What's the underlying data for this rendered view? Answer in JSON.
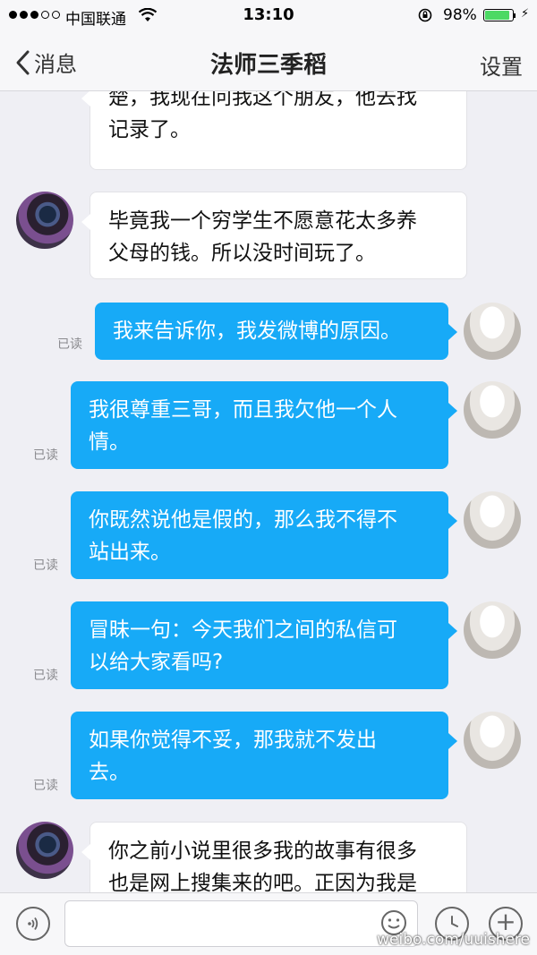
{
  "status_bar": {
    "carrier": "中国联通",
    "time": "13:10",
    "battery": "98%"
  },
  "nav": {
    "back_label": "消息",
    "title": "法师三季稻",
    "settings_label": "设置"
  },
  "messages": [
    {
      "side": "in",
      "lines": [
        "楚，我现在问我这个朋友，他去找",
        "记录了。"
      ]
    },
    {
      "side": "in",
      "lines": [
        "毕竟我一个穷学生不愿意花太多养",
        "父母的钱。所以没时间玩了。"
      ]
    },
    {
      "side": "out",
      "read": "已读",
      "lines": [
        "我来告诉你，我发微博的原因。"
      ]
    },
    {
      "side": "out",
      "read": "已读",
      "lines": [
        "我很尊重三哥，而且我欠他一个人",
        "情。"
      ]
    },
    {
      "side": "out",
      "read": "已读",
      "lines": [
        "你既然说他是假的，那么我不得不",
        "站出来。"
      ]
    },
    {
      "side": "out",
      "read": "已读",
      "lines": [
        "冒昧一句：今天我们之间的私信可",
        "以给大家看吗?"
      ]
    },
    {
      "side": "out",
      "read": "已读",
      "lines": [
        "如果你觉得不妥，那我就不发出",
        "去。"
      ]
    },
    {
      "side": "in",
      "lines": [
        "你之前小说里很多我的故事有很多",
        "也是网上搜集来的吧。正因为我是"
      ]
    }
  ],
  "input": {
    "placeholder": ""
  },
  "watermark": "weibo.com/uuishere",
  "colors": {
    "outgoing_bubble": "#17aaf7",
    "incoming_bubble": "#ffffff",
    "background": "#efeff4",
    "battery": "#4cd964"
  },
  "icons": {
    "back": "chevron-left-icon",
    "voice": "voice-icon",
    "emoji": "emoji-icon",
    "history": "clock-icon",
    "plus": "plus-icon"
  }
}
